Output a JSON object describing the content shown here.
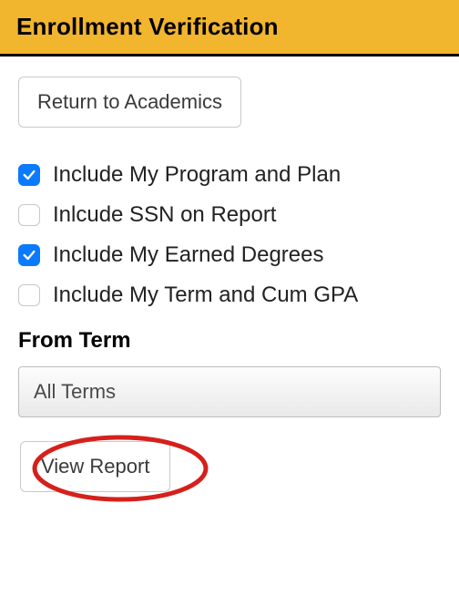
{
  "header": {
    "title": "Enrollment Verification"
  },
  "buttons": {
    "return_label": "Return to Academics",
    "view_report_label": "View Report"
  },
  "options": [
    {
      "label": "Include My Program and Plan",
      "checked": true,
      "name": "opt-program-plan"
    },
    {
      "label": "Inlcude SSN on Report",
      "checked": false,
      "name": "opt-ssn"
    },
    {
      "label": "Include My Earned Degrees",
      "checked": true,
      "name": "opt-earned-degrees"
    },
    {
      "label": "Include My Term and Cum GPA",
      "checked": false,
      "name": "opt-term-cum-gpa"
    }
  ],
  "from_term": {
    "label": "From Term",
    "selected": "All Terms"
  },
  "annotation": {
    "color": "#d5201b"
  }
}
